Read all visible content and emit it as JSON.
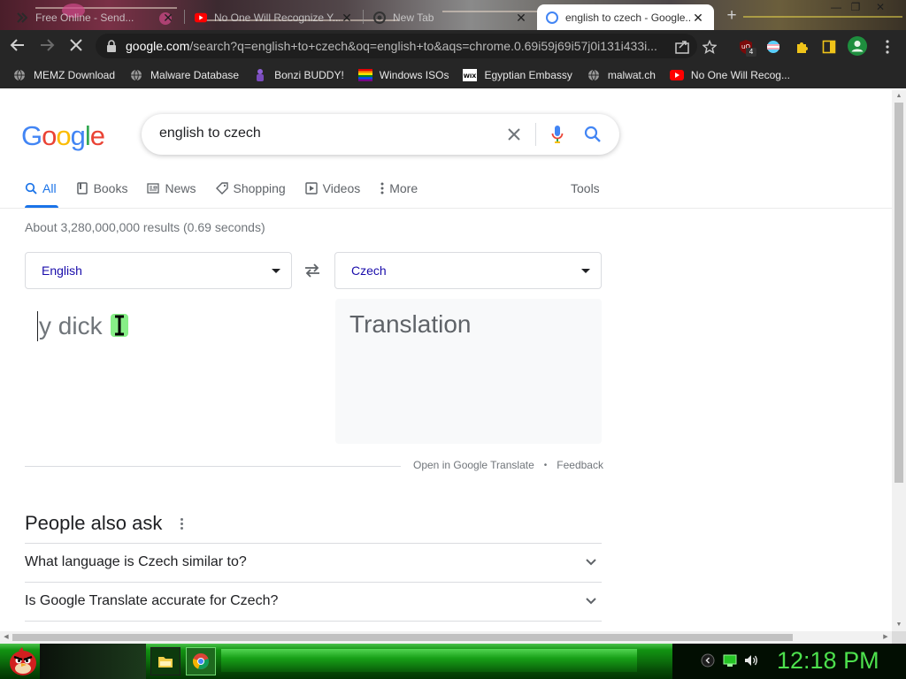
{
  "browser": {
    "tabs": [
      {
        "title": "Free Online - Send..."
      },
      {
        "title": "No One Will Recognize Y..."
      },
      {
        "title": "New Tab"
      },
      {
        "title": "english to czech - Google..."
      }
    ],
    "url_host": "google.com",
    "url_rest": "/search?q=english+to+czech&oq=english+to&aqs=chrome.0.69i59j69i57j0i131i433i...",
    "extension_badge": "4"
  },
  "bookmarks": [
    {
      "label": "MEMZ Download"
    },
    {
      "label": "Malware Database"
    },
    {
      "label": "Bonzi BUDDY!"
    },
    {
      "label": "Windows ISOs"
    },
    {
      "label": "Egyptian Embassy"
    },
    {
      "label": "malwat.ch"
    },
    {
      "label": "No One Will Recog..."
    }
  ],
  "search": {
    "logo": "Google",
    "query": "english to czech",
    "tabs": [
      "All",
      "Books",
      "News",
      "Shopping",
      "Videos",
      "More"
    ],
    "tools": "Tools",
    "stats": "About 3,280,000,000 results (0.69 seconds)"
  },
  "translate": {
    "source_lang": "English",
    "target_lang": "Czech",
    "source_text": "y dick",
    "target_text": "Translation",
    "open_link": "Open in Google Translate",
    "separator": "•",
    "feedback": "Feedback"
  },
  "paa": {
    "title": "People also ask",
    "questions": [
      "What language is Czech similar to?",
      "Is Google Translate accurate for Czech?"
    ]
  },
  "taskbar": {
    "clock": "12:18 PM"
  },
  "colors": {
    "google_blue": "#4285f4",
    "google_red": "#ea4335",
    "google_yellow": "#fbbc05",
    "google_green": "#34a853",
    "accent": "#1a73e8",
    "clock": "#4de04d"
  }
}
